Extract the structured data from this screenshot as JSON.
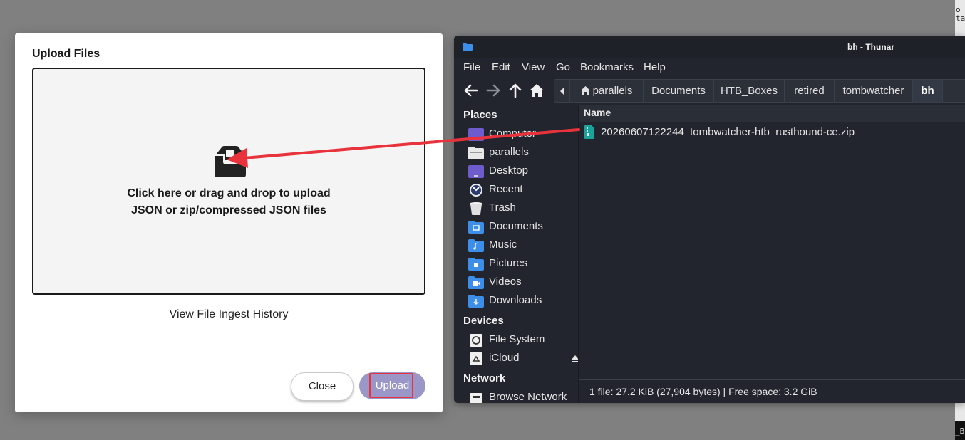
{
  "terminal": {
    "fragments": [
      "o",
      "ta",
      "_B"
    ]
  },
  "dialog": {
    "title": "Upload Files",
    "dropzone": {
      "icon": "inbox-tray-icon",
      "line1": "Click here or drag and drop to upload",
      "line2": "JSON or zip/compressed JSON files"
    },
    "history_link": "View File Ingest History",
    "close_label": "Close",
    "upload_label": "Upload",
    "accent_color": "#9b96c8",
    "highlight_color": "#e8333c"
  },
  "thunar": {
    "title": "bh - Thunar",
    "menu": [
      "File",
      "Edit",
      "View",
      "Go",
      "Bookmarks",
      "Help"
    ],
    "breadcrumbs": [
      "parallels",
      "Documents",
      "HTB_Boxes",
      "retired",
      "tombwatcher",
      "bh"
    ],
    "sidebar": {
      "places_heading": "Places",
      "places": [
        {
          "label": "Computer",
          "icon": "computer-icon"
        },
        {
          "label": "parallels",
          "icon": "home-folder-icon"
        },
        {
          "label": "Desktop",
          "icon": "desktop-icon"
        },
        {
          "label": "Recent",
          "icon": "recent-icon"
        },
        {
          "label": "Trash",
          "icon": "trash-icon"
        },
        {
          "label": "Documents",
          "icon": "documents-folder-icon"
        },
        {
          "label": "Music",
          "icon": "music-folder-icon"
        },
        {
          "label": "Pictures",
          "icon": "pictures-folder-icon"
        },
        {
          "label": "Videos",
          "icon": "videos-folder-icon"
        },
        {
          "label": "Downloads",
          "icon": "downloads-folder-icon"
        }
      ],
      "devices_heading": "Devices",
      "devices": [
        {
          "label": "File System",
          "icon": "drive-icon"
        },
        {
          "label": "iCloud",
          "icon": "network-drive-icon"
        }
      ],
      "network_heading": "Network",
      "network": [
        {
          "label": "Browse Network",
          "icon": "network-icon"
        }
      ]
    },
    "column_name": "Name",
    "files": [
      {
        "name": "20260607122244_tombwatcher-htb_rusthound-ce.zip",
        "icon": "zip-file-icon"
      }
    ],
    "status": "1 file: 27.2 KiB (27,904 bytes)  |  Free space: 3.2 GiB"
  }
}
